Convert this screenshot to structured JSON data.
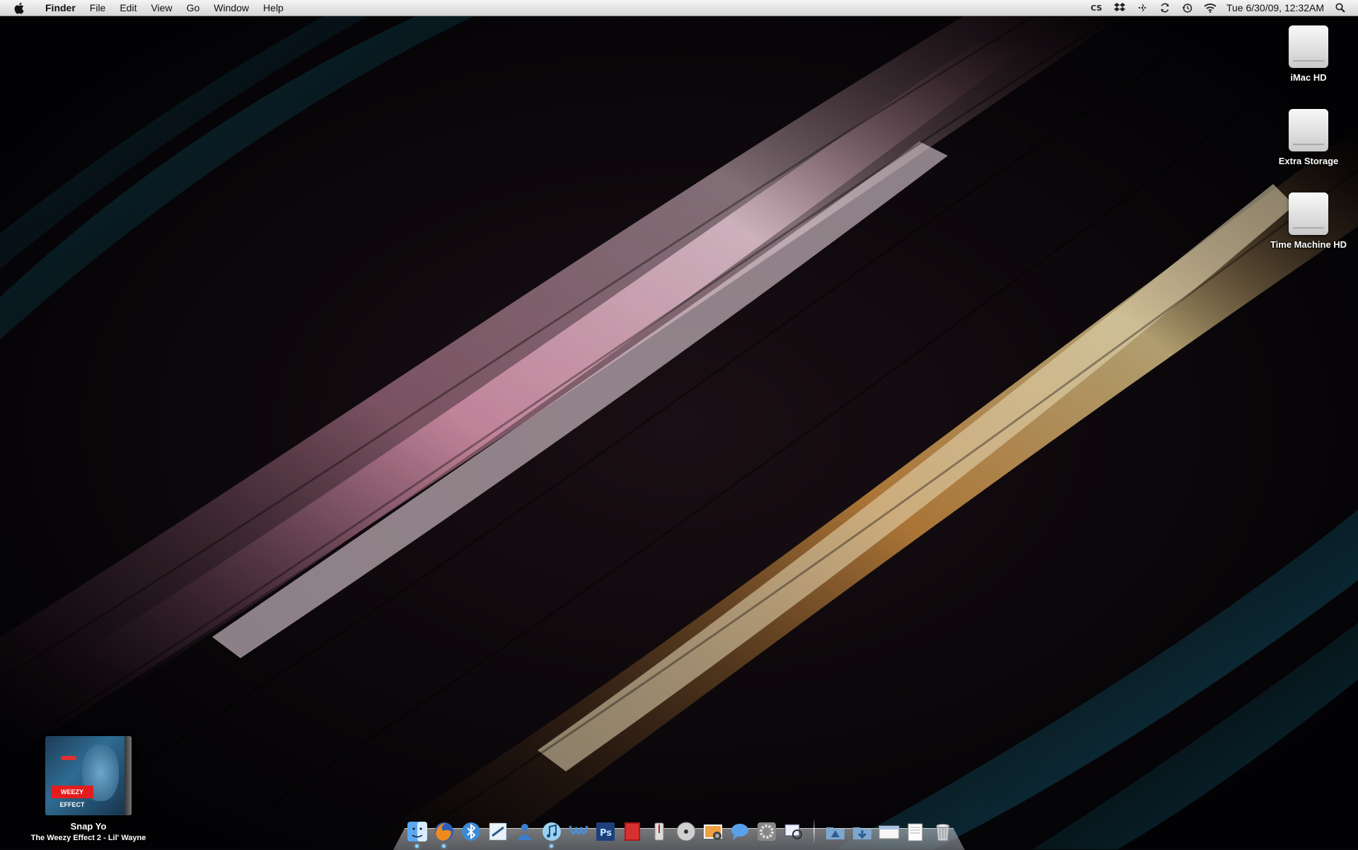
{
  "menubar": {
    "app_name": "Finder",
    "menus": [
      "File",
      "Edit",
      "View",
      "Go",
      "Window",
      "Help"
    ],
    "clock": "Tue 6/30/09, 12:32AM",
    "status_icons": [
      "creative-suite-icon",
      "dropbox-icon",
      "bluetooth-icon",
      "sync-icon",
      "time-machine-icon",
      "wifi-icon",
      "spotlight-icon"
    ]
  },
  "desktop": {
    "drives": [
      {
        "label": "iMac HD"
      },
      {
        "label": "Extra Storage"
      },
      {
        "label": "Time Machine HD"
      }
    ]
  },
  "now_playing": {
    "track": "Snap Yo",
    "album_artist": "The Weezy Effect 2 - Lil' Wayne",
    "art_text": "WEEZY EFFECT"
  },
  "dock": {
    "apps": [
      "finder-icon",
      "firefox-icon",
      "bluetooth-file-exchange-icon",
      "mail-stamp-icon",
      "address-book-icon",
      "itunes-icon",
      "textwrangler-icon",
      "photoshop-icon",
      "flash-icon",
      "instruments-icon",
      "dvd-player-icon",
      "iphoto-icon",
      "ichat-icon",
      "system-preferences-icon",
      "preview-icon"
    ],
    "stacks": [
      "applications-stack-icon",
      "downloads-stack-icon",
      "documents-stack-icon",
      "file-stack-icon",
      "trash-icon"
    ],
    "photoshop_label": "Ps"
  },
  "colors": {
    "menubar_top": "#f4f4f4",
    "menubar_bottom": "#d6d6d6",
    "wallpaper_base": "#050507",
    "streak_pink": "#e8a0b8",
    "streak_orange": "#f5b050",
    "streak_teal": "#1d6a73"
  }
}
